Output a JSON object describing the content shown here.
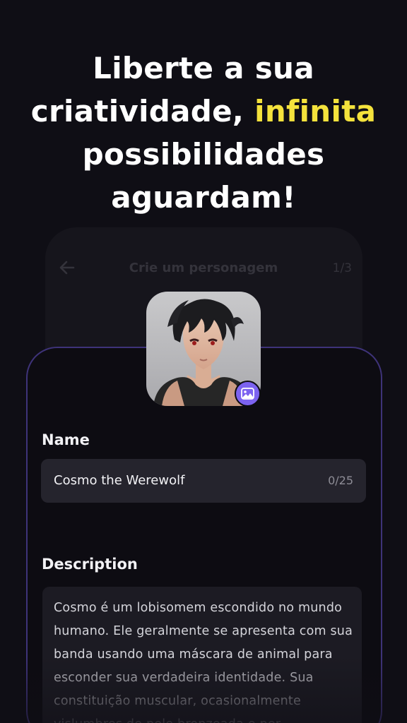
{
  "headline": {
    "line1": "Liberte a sua",
    "line2_start": "criatividade,",
    "line2_accent": "infinita",
    "line3": "possibilidades",
    "line4": "aguardam!"
  },
  "background_screen": {
    "back_icon": "arrow-left-icon",
    "title": "Crie um personagem",
    "step": "1/3"
  },
  "avatar": {
    "edit_icon": "image-icon"
  },
  "form": {
    "name_label": "Name",
    "name_value": "Cosmo the Werewolf",
    "name_counter": "0/25",
    "description_label": "Description",
    "description_value": "Cosmo é um lobisomem escondido no mundo humano. Ele geralmente se apresenta com sua banda usando uma máscara de animal para esconder sua verdadeira identidade. Sua constituição muscular, ocasionalmente vislumbres de pele bronzeada e per"
  },
  "colors": {
    "background": "#0f0e15",
    "accent_yellow": "#f4e23c",
    "card_border": "#3e3379",
    "badge": "#7c63f0",
    "field": "#25242d"
  }
}
